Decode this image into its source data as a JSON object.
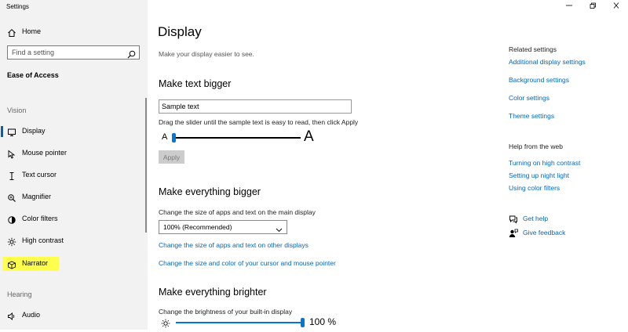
{
  "window": {
    "title": "Settings",
    "controls": [
      "minimize",
      "restore",
      "close"
    ]
  },
  "sidebar": {
    "home_label": "Home",
    "search_placeholder": "Find a setting",
    "section_title": "Ease of Access",
    "groups": [
      {
        "label": "Vision",
        "items": [
          {
            "label": "Display",
            "icon": "monitor-icon",
            "selected": true
          },
          {
            "label": "Mouse pointer",
            "icon": "mouse-pointer-icon"
          },
          {
            "label": "Text cursor",
            "icon": "text-cursor-icon"
          },
          {
            "label": "Magnifier",
            "icon": "magnifier-icon"
          },
          {
            "label": "Color filters",
            "icon": "color-filters-icon"
          },
          {
            "label": "High contrast",
            "icon": "high-contrast-icon"
          },
          {
            "label": "Narrator",
            "icon": "narrator-icon",
            "highlighted": true
          }
        ]
      },
      {
        "label": "Hearing",
        "items": [
          {
            "label": "Audio",
            "icon": "speaker-icon"
          }
        ]
      }
    ],
    "highlight_color": "#ffff4d",
    "accent_color": "#0063b1"
  },
  "main": {
    "title": "Display",
    "subtitle": "Make your display easier to see.",
    "text_bigger": {
      "heading": "Make text bigger",
      "sample_value": "Sample text",
      "instruction": "Drag the slider until the sample text is easy to read, then click Apply",
      "small_glyph": "A",
      "large_glyph": "A",
      "slider_fraction": 0,
      "apply_label": "Apply"
    },
    "everything_bigger": {
      "heading": "Make everything bigger",
      "description": "Change the size of apps and text on the main display",
      "selected_option": "100% (Recommended)",
      "link_other_displays": "Change the size of apps and text on other displays",
      "link_cursor": "Change the size and color of your cursor and mouse pointer"
    },
    "everything_brighter": {
      "heading": "Make everything brighter",
      "description": "Change the brightness of your built-in display",
      "brightness_value": "100 %",
      "brightness_fraction": 1
    }
  },
  "right_panel": {
    "related_title": "Related settings",
    "related_links": [
      "Additional display settings",
      "Background settings",
      "Color settings",
      "Theme settings"
    ],
    "help_title": "Help from the web",
    "help_links": [
      "Turning on high contrast",
      "Setting up night light",
      "Using color filters"
    ],
    "get_help": "Get help",
    "give_feedback": "Give feedback"
  },
  "link_color": "#0067c0"
}
